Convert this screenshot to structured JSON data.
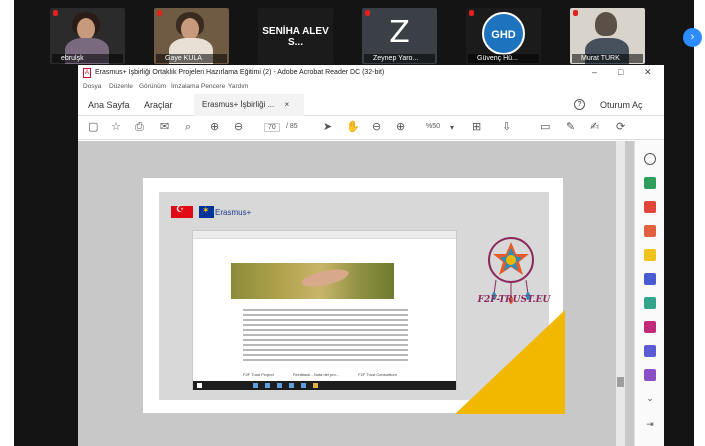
{
  "participants": [
    {
      "name": "ebrulşk",
      "type": "video"
    },
    {
      "name": "Gaye KULA",
      "type": "video"
    },
    {
      "name": "SENİHA ALEV S...",
      "type": "name-only"
    },
    {
      "name": "Zeynep Yaro...",
      "type": "initial",
      "initial": "Z"
    },
    {
      "name": "Güvenç Hü...",
      "type": "logo",
      "logo_text": "GHD"
    },
    {
      "name": "Murat TÜRK",
      "type": "video"
    }
  ],
  "meeting": {
    "next_page_icon": "chevron-right-icon"
  },
  "acrobat": {
    "title": "Erasmus+ İşbirliği Ortaklık Projeleri Hazırlama Eğitimi (2) - Adobe Acrobat Reader DC (32-bit)",
    "menu": [
      "Dosya",
      "Düzenle",
      "Görünüm",
      "İmzalama",
      "Pencere",
      "Yardım"
    ],
    "tabs": {
      "home": "Ana Sayfa",
      "tools": "Araçlar",
      "document": "Erasmus+ İşbirliği ...",
      "close": "×"
    },
    "signin": "Oturum Aç",
    "help": "?",
    "page_current": "70",
    "page_total": "/ 85",
    "zoom": "%50",
    "window_controls": {
      "minimize": "–",
      "maximize": "□",
      "close": "✕"
    }
  },
  "slide": {
    "erasmus_label": "Erasmus+",
    "logo_caption": "F2F-TRUST.EU",
    "footer_items": [
      "F2F Trust Project",
      "Feedback - Nota del pro...",
      "F2F Trust Consortium"
    ]
  },
  "colors": {
    "meeting_bg": "#141414",
    "accent_blue": "#2d8cff",
    "pdf_red": "#c8102e",
    "triangle_yellow": "#f2b800",
    "logo_purple": "#8a2a5c"
  }
}
